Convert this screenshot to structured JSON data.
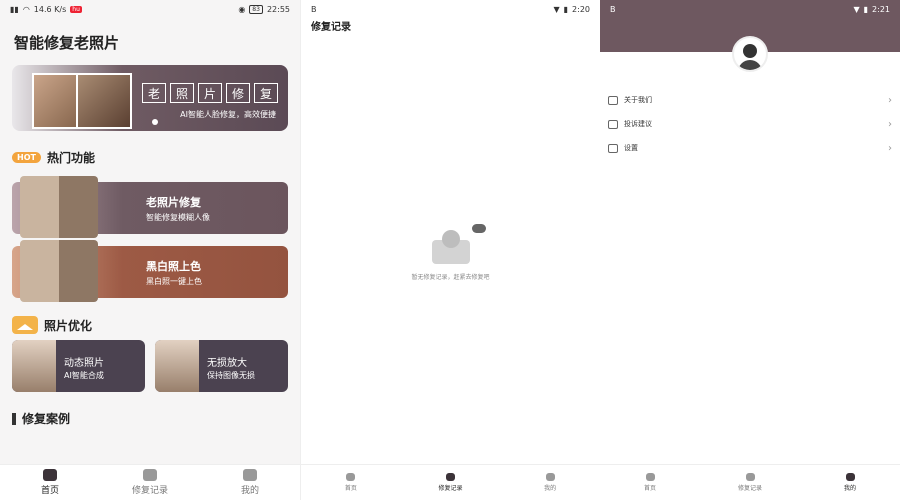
{
  "panel1": {
    "status": {
      "left": "14.6 K/s",
      "chip": "hu",
      "battery": "83",
      "time": "22:55"
    },
    "app_title": "智能修复老照片",
    "banner": {
      "tiles": [
        "老",
        "照",
        "片",
        "修",
        "复"
      ],
      "caption": "AI智能人脸修复，高效便捷"
    },
    "hot": {
      "badge": "HOT",
      "title": "热门功能"
    },
    "features": [
      {
        "title": "老照片修复",
        "subtitle": "智能修复模糊人像"
      },
      {
        "title": "黑白照上色",
        "subtitle": "黑白照一键上色"
      }
    ],
    "photo_opt": {
      "title": "照片优化"
    },
    "cards": [
      {
        "title": "动态照片",
        "subtitle": "AI智能合成"
      },
      {
        "title": "无损放大",
        "subtitle": "保持图像无损"
      }
    ],
    "cases": {
      "title": "修复案例"
    },
    "nav": [
      {
        "label": "首页"
      },
      {
        "label": "修复记录"
      },
      {
        "label": "我的"
      }
    ]
  },
  "panel2": {
    "status": {
      "left": "B",
      "time": "2:20"
    },
    "title": "修复记录",
    "empty_text": "暂无修复记录，赶紧去修复吧",
    "nav": [
      {
        "label": "首页"
      },
      {
        "label": "修复记录"
      },
      {
        "label": "我的"
      }
    ]
  },
  "panel3": {
    "status": {
      "left": "B",
      "time": "2:21"
    },
    "menu": [
      {
        "label": "关于我们"
      },
      {
        "label": "投诉建议"
      },
      {
        "label": "设置"
      }
    ],
    "chevron": "›",
    "nav": [
      {
        "label": "首页"
      },
      {
        "label": "修复记录"
      },
      {
        "label": "我的"
      }
    ]
  }
}
